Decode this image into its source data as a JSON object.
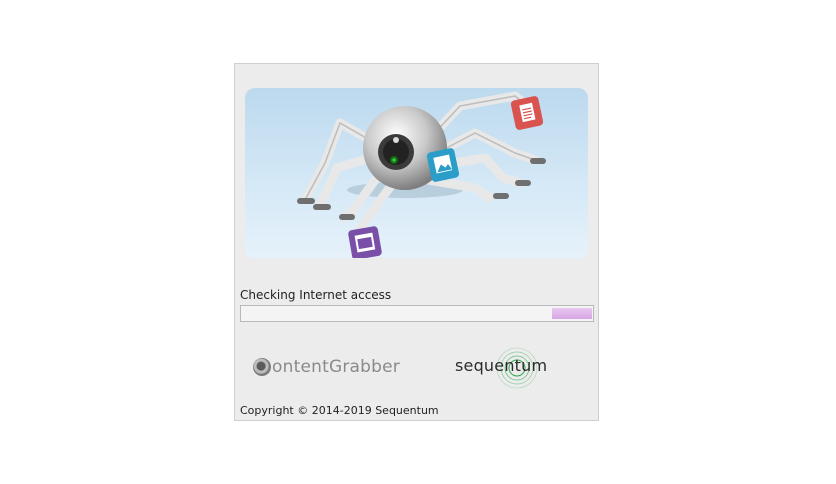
{
  "splash": {
    "status_text": "Checking Internet access",
    "progress_segment_color": "#d9acdf",
    "copyright": "Copyright © 2014-2019 Sequentum"
  },
  "logos": {
    "contentgrabber": "ontentGrabber",
    "sequentum": "sequentum"
  },
  "icons": {
    "banner": "spider-robot-illustration",
    "document": "document-icon",
    "image": "image-icon",
    "video": "video-icon"
  },
  "colors": {
    "document_icon": "#d9534f",
    "image_icon": "#2a9ec9",
    "video_icon": "#7a4fa8",
    "sequentum_rings": "#2fa84f"
  }
}
